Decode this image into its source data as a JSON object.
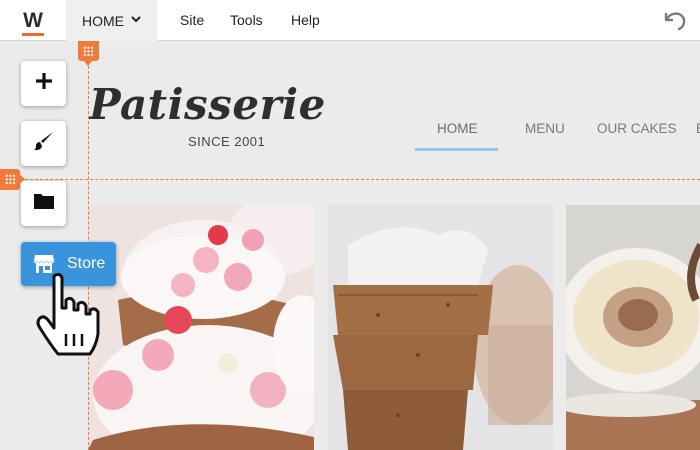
{
  "editor": {
    "logo": "W",
    "page_dropdown": "HOME",
    "menu": [
      "Site",
      "Tools",
      "Help"
    ]
  },
  "site": {
    "title": "Patisserie",
    "tagline": "SINCE 2001",
    "nav": [
      "HOME",
      "MENU",
      "OUR CAKES",
      "E"
    ],
    "active_nav": "HOME"
  },
  "tools": {
    "add": "plus-icon",
    "design": "brush-icon",
    "files": "folder-icon",
    "store_label": "Store"
  },
  "colors": {
    "accent": "#ef7a3a",
    "store": "#3a94dd",
    "nav_underline": "#8ecde6"
  }
}
